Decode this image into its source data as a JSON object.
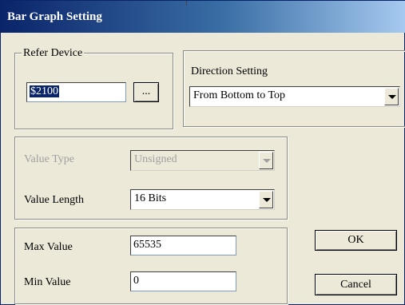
{
  "window": {
    "title": "Bar Graph Setting"
  },
  "refer_device": {
    "legend": "Refer Device",
    "value": "$2100",
    "browse_label": "..."
  },
  "direction": {
    "label": "Direction Setting",
    "selected": "From Bottom to Top"
  },
  "value_type": {
    "label": "Value Type",
    "selected": "Unsigned",
    "enabled": false
  },
  "value_length": {
    "label": "Value Length",
    "selected": "16 Bits"
  },
  "range": {
    "max_label": "Max Value",
    "max_value": "65535",
    "min_label": "Min Value",
    "min_value": "0"
  },
  "buttons": {
    "ok": "OK",
    "cancel": "Cancel"
  }
}
